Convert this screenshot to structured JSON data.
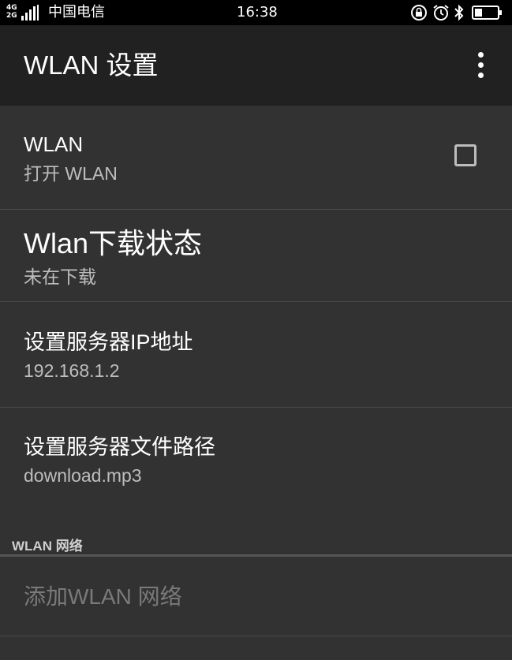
{
  "status_bar": {
    "network_top": "4G",
    "network_bottom": "2G",
    "carrier": "中国电信",
    "time": "16:38",
    "icons": [
      "lock-rotation-icon",
      "alarm-icon",
      "bluetooth-icon",
      "battery-icon"
    ]
  },
  "app_bar": {
    "title": "WLAN 设置",
    "overflow_icon": "more-vert-icon"
  },
  "preferences": [
    {
      "title": "WLAN",
      "summary": "打开 WLAN",
      "checked": false
    },
    {
      "title": "Wlan下载状态",
      "summary": "未在下载"
    },
    {
      "title": "设置服务器IP地址",
      "summary": "192.168.1.2"
    },
    {
      "title": "设置服务器文件路径",
      "summary": "download.mp3"
    }
  ],
  "category": {
    "label": "WLAN 网络",
    "add_network": "添加WLAN 网络"
  },
  "colors": {
    "background": "#323232",
    "app_bar": "#212121",
    "status_bar": "#000000",
    "summary_text": "#bdbdbd",
    "disabled_text": "#7a7a7a"
  }
}
